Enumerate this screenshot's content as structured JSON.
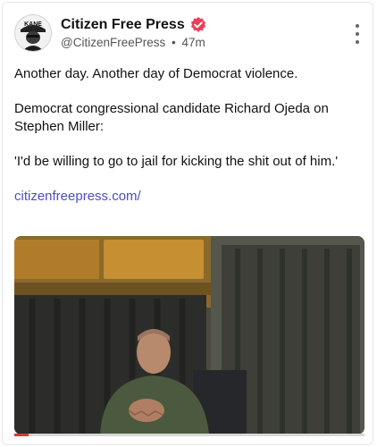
{
  "post": {
    "author_name": "Citizen Free Press",
    "handle": "@CitizenFreePress",
    "separator": "•",
    "time": "47m",
    "avatar_text": "KANE",
    "paragraphs": [
      "Another day. Another day of Democrat violence.",
      "Democrat congressional candidate Richard Ojeda on Stephen Miller:",
      "'I'd be willing to go to jail for kicking the shit out of him.'"
    ],
    "link_text": "citizenfreepress.com/"
  },
  "icons": {
    "verified": "verified-badge-icon",
    "more": "more-options-icon"
  },
  "colors": {
    "verified_badge": "#e8405a",
    "link": "#4a4ec8",
    "progress_fill": "#d23c3c"
  },
  "video": {
    "progress": 0.04
  }
}
